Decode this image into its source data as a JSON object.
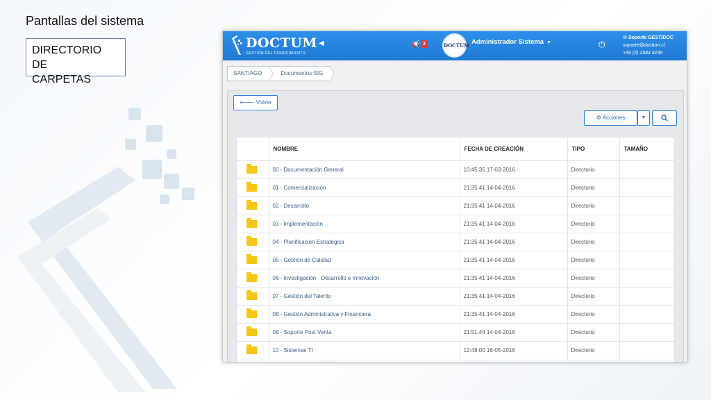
{
  "slide": {
    "title": "Pantallas del sistema",
    "section_line1": "DIRECTORIO DE",
    "section_line2": "CARPETAS"
  },
  "app": {
    "logo_text": "DOCTUM",
    "logo_subtitle": "GESTIÓN DEL CONOCIMIENTO",
    "notifications_count": "2",
    "avatar_text": "DOCTUM",
    "user_name": "Administrador Sistema",
    "support": {
      "title": "Soporte GESTIDOC",
      "email": "soporte@doctum.cl",
      "phone": "+56 (2) 2584 8190"
    },
    "accent_color": "#2584e0",
    "folder_color": "#f5c518"
  },
  "breadcrumb": [
    "SANTIAGO",
    "Documentos SIG"
  ],
  "toolbar": {
    "back_label": "Volver",
    "actions_label": "Acciones"
  },
  "table": {
    "columns": [
      "NOMBRE",
      "FECHA DE CREACIÓN",
      "TIPO",
      "TAMAÑO"
    ],
    "rows": [
      {
        "name": "00 - Documentación General",
        "date": "10:45:35 17-03-2016",
        "type": "Directorio",
        "size": ""
      },
      {
        "name": "01 - Comercialización",
        "date": "21:35:41 14-04-2016",
        "type": "Directorio",
        "size": ""
      },
      {
        "name": "02 - Desarrollo",
        "date": "21:35:41 14-04-2016",
        "type": "Directorio",
        "size": ""
      },
      {
        "name": "03 - Implementación",
        "date": "21:35:41 14-04-2016",
        "type": "Directorio",
        "size": ""
      },
      {
        "name": "04 - Planificación Estratégica",
        "date": "21:35:41 14-04-2016",
        "type": "Directorio",
        "size": ""
      },
      {
        "name": "05 - Gestión de Calidad",
        "date": "21:35:41 14-04-2016",
        "type": "Directorio",
        "size": ""
      },
      {
        "name": "06 - Investigación - Desarrollo e Innovación",
        "date": "21:35:41 14-04-2016",
        "type": "Directorio",
        "size": ""
      },
      {
        "name": "07 - Gestión del Talento",
        "date": "21:35:41 14-04-2016",
        "type": "Directorio",
        "size": ""
      },
      {
        "name": "08 - Gestión Administrativa y Financiera",
        "date": "21:35:41 14-04-2016",
        "type": "Directorio",
        "size": ""
      },
      {
        "name": "09 - Soporte Post Venta",
        "date": "21:51:44 14-04-2016",
        "type": "Directorio",
        "size": ""
      },
      {
        "name": "10 - Sistemas TI",
        "date": "12:48:00 16-05-2016",
        "type": "Directorio",
        "size": ""
      }
    ]
  }
}
